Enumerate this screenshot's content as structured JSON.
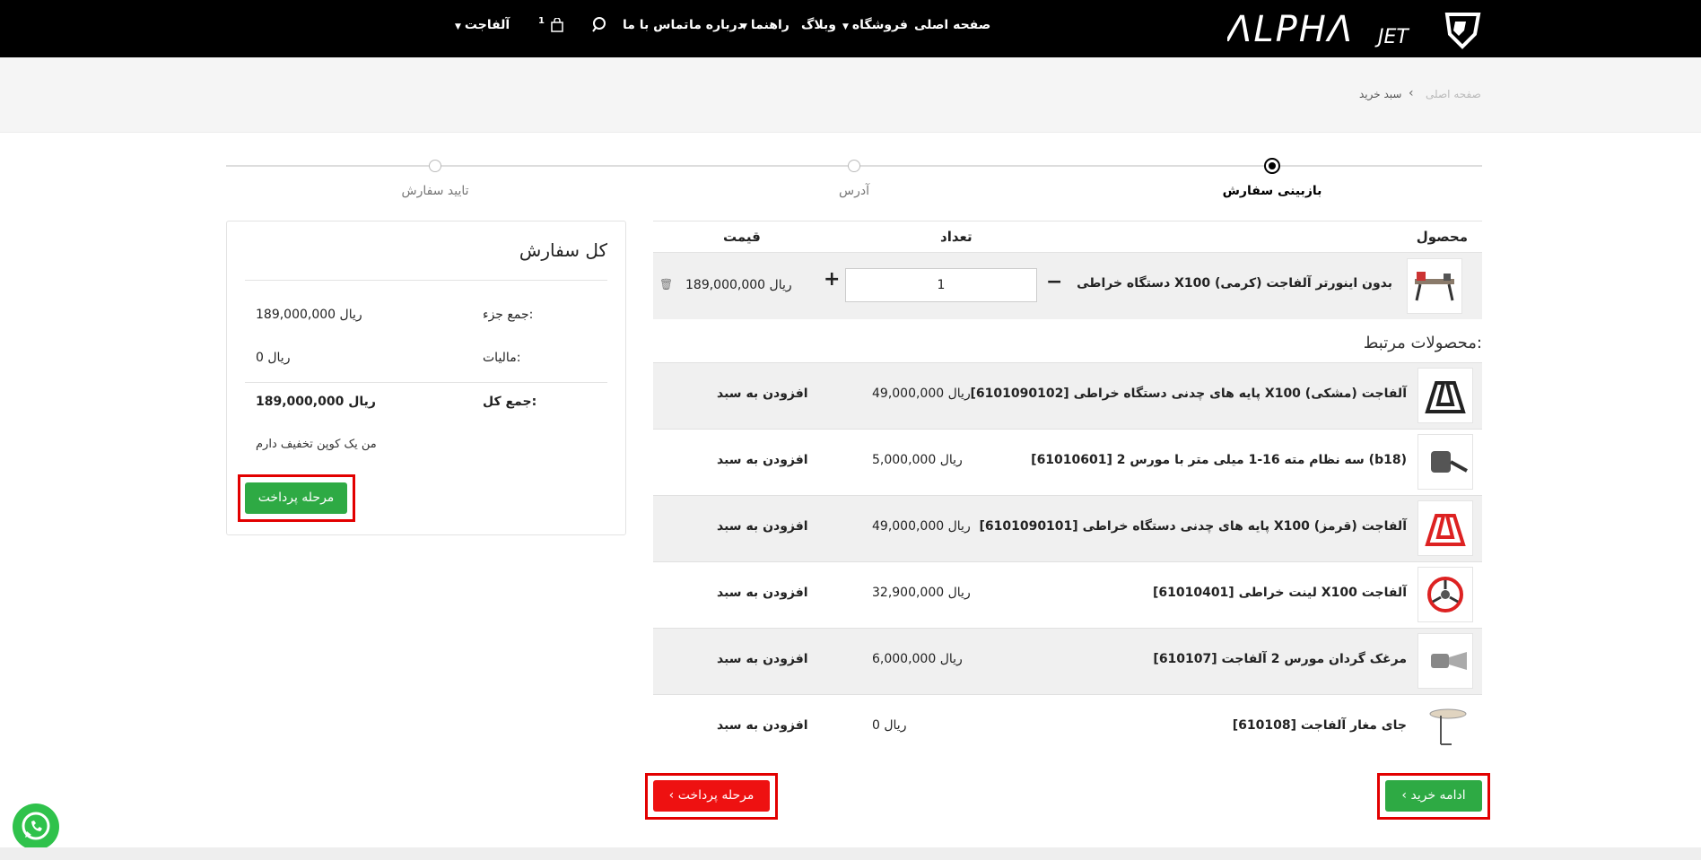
{
  "header": {
    "logo_text": "ΛLPHΛ",
    "logo_sub": "JET",
    "nav": {
      "home": "صفحه اصلی",
      "shop": "فروشگاه",
      "blog": "وبلاگ",
      "guides": "راهنما",
      "about": "درباره ما",
      "contact": "تماس با ما",
      "cart_count": "1",
      "account": "آلفاجت"
    }
  },
  "breadcrumb": {
    "home": "صفحه اصلی",
    "current": "سبد خرید"
  },
  "steps": [
    {
      "label": "بازبینی سفارش",
      "active": true
    },
    {
      "label": "آدرس",
      "active": false
    },
    {
      "label": "تایید سفارش",
      "active": false
    }
  ],
  "summary": {
    "title": "کل سفارش",
    "subtotal_label": "جمع جزء:",
    "subtotal_value": "189,000,000 ریال",
    "tax_label": "مالیات:",
    "tax_value": "0 ریال",
    "total_label": "جمع کل:",
    "total_value": "189,000,000 ریال",
    "coupon_text": "من یک کوپن تخفیف دارم",
    "checkout_button": "مرحله پرداخت"
  },
  "cart": {
    "headers": {
      "product": "محصول",
      "quantity": "تعداد",
      "price": "قیمت"
    },
    "item": {
      "name": "دستگاه خراطی X100 بدون اینورتر آلفاجت (کرمی)",
      "quantity": "1",
      "price": "189,000,000 ریال"
    }
  },
  "related": {
    "title": "محصولات مرتبط:",
    "add_label": "افزودن به سبد",
    "items": [
      {
        "name": "[6101090102] پایه های چدنی دستگاه خراطی X100 آلفاجت (مشکی)",
        "price": "49,000,000 ریال"
      },
      {
        "name": "[61010601] سه نظام مته 16-1 میلی متر با مورس 2 (b18)",
        "price": "5,000,000 ریال"
      },
      {
        "name": "[6101090101] پایه های چدنی دستگاه خراطی X100 آلفاجت (قرمز)",
        "price": "49,000,000 ریال"
      },
      {
        "name": "[61010401] لینت خراطی X100 آلفاجت",
        "price": "32,900,000 ریال"
      },
      {
        "name": "[610107] مرغک گردان مورس 2 آلفاجت",
        "price": "6,000,000 ریال"
      },
      {
        "name": "[610108] جای مغار آلفاجت",
        "price": "0 ریال"
      }
    ]
  },
  "actions": {
    "continue_shopping": "ادامه خرید",
    "go_to_payment": "مرحله پرداخت"
  },
  "colors": {
    "header_bg": "#000000",
    "primary_green": "#2eaa44",
    "danger_red": "#ee1111",
    "highlight_red": "#e20000",
    "whatsapp_green": "#2fc24b"
  }
}
